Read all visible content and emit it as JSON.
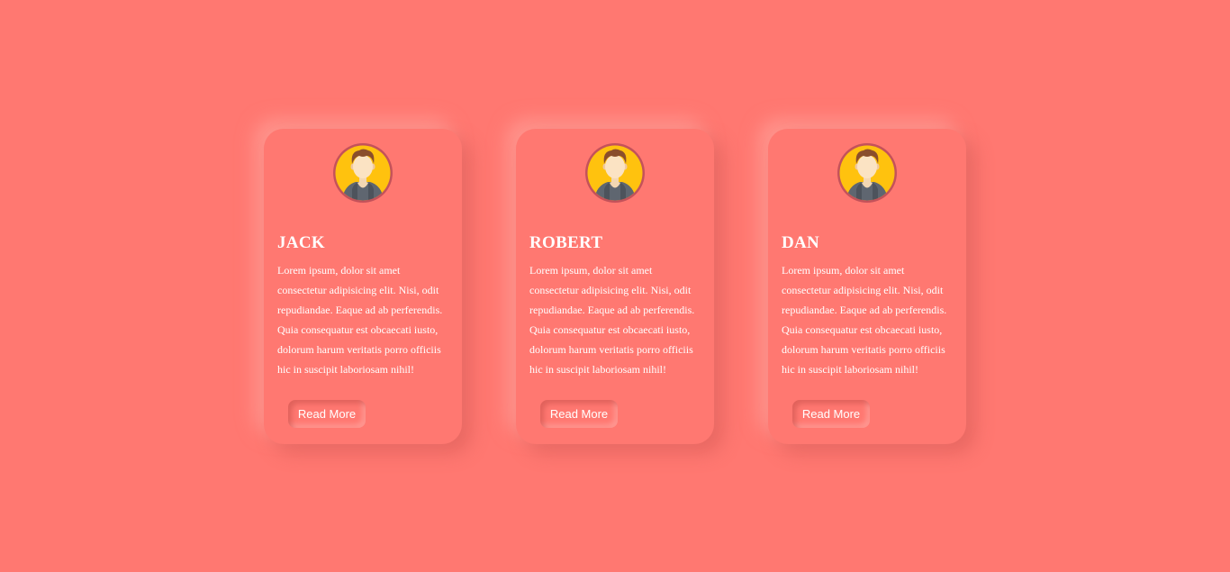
{
  "cards": [
    {
      "name": "JACK",
      "description": "Lorem ipsum, dolor sit amet consectetur adipisicing elit. Nisi, odit repudiandae. Eaque ad ab perferendis. Quia consequatur est obcaecati iusto, dolorum harum veritatis porro officiis hic in suscipit laboriosam nihil!",
      "button_label": "Read More"
    },
    {
      "name": "ROBERT",
      "description": "Lorem ipsum, dolor sit amet consectetur adipisicing elit. Nisi, odit repudiandae. Eaque ad ab perferendis. Quia consequatur est obcaecati iusto, dolorum harum veritatis porro officiis hic in suscipit laboriosam nihil!",
      "button_label": "Read More"
    },
    {
      "name": "DAN",
      "description": "Lorem ipsum, dolor sit amet consectetur adipisicing elit. Nisi, odit repudiandae. Eaque ad ab perferendis. Quia consequatur est obcaecati iusto, dolorum harum veritatis porro officiis hic in suscipit laboriosam nihil!",
      "button_label": "Read More"
    }
  ],
  "avatar_icon": "male-user-avatar-icon",
  "colors": {
    "background": "#ff7871",
    "avatar_bg": "#ffc20e",
    "text": "#ffffff"
  }
}
